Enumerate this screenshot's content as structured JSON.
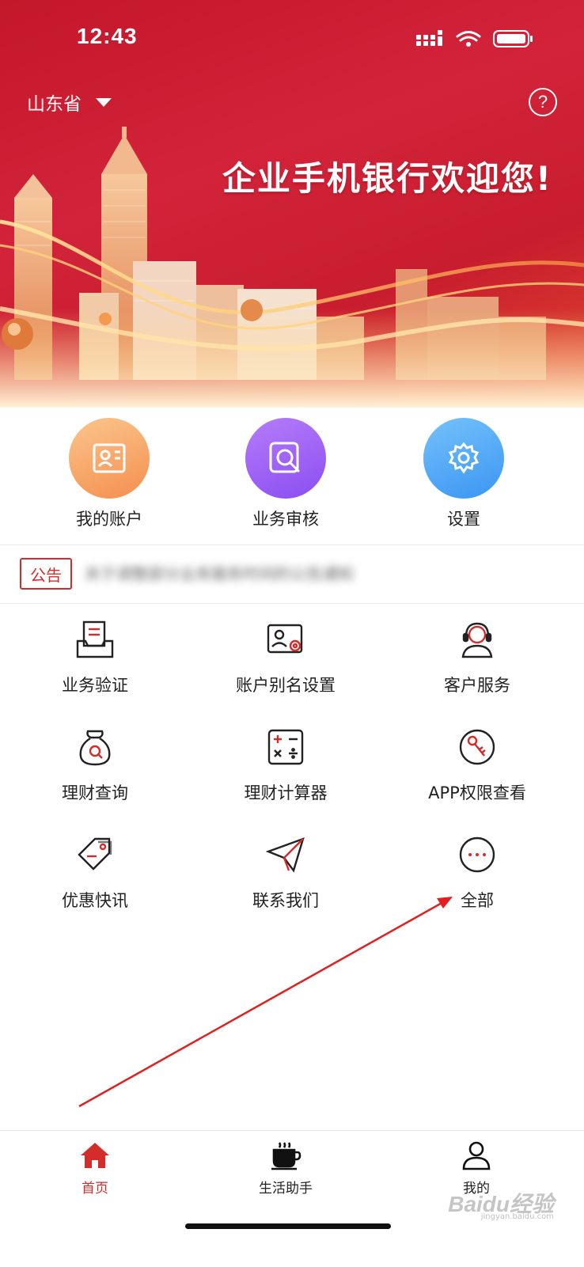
{
  "status_bar": {
    "time": "12:43"
  },
  "header": {
    "region": "山东省",
    "help_symbol": "?",
    "welcome": "企业手机银行欢迎您!"
  },
  "quick_actions": [
    {
      "label": "我的账户",
      "icon": "account-card-icon",
      "color": "#f7a35c"
    },
    {
      "label": "业务审核",
      "icon": "search-review-icon",
      "color": "#9a5cf5"
    },
    {
      "label": "设置",
      "icon": "gear-icon",
      "color": "#4aa6f7"
    }
  ],
  "notice": {
    "tag": "公告",
    "text": "关于调整部分业务服务时间的公告通知"
  },
  "services": [
    {
      "label": "业务验证",
      "icon": "document-tray-icon"
    },
    {
      "label": "账户别名设置",
      "icon": "id-card-gear-icon"
    },
    {
      "label": "客户服务",
      "icon": "headset-agent-icon"
    },
    {
      "label": "理财查询",
      "icon": "money-bag-search-icon"
    },
    {
      "label": "理财计算器",
      "icon": "calculator-icon"
    },
    {
      "label": "APP权限查看",
      "icon": "key-icon"
    },
    {
      "label": "优惠快讯",
      "icon": "tag-icon"
    },
    {
      "label": "联系我们",
      "icon": "paper-plane-icon"
    },
    {
      "label": "全部",
      "icon": "more-dots-icon"
    }
  ],
  "tabbar": [
    {
      "label": "首页",
      "icon": "home-icon",
      "active": true
    },
    {
      "label": "生活助手",
      "icon": "coffee-cup-icon",
      "active": false
    },
    {
      "label": "我的",
      "icon": "user-icon",
      "active": false
    }
  ],
  "watermark": {
    "text": "Baidu经验",
    "sub": "jingyan.baidu.com"
  },
  "colors": {
    "brand_red": "#c81d2e",
    "accent_red": "#d42b2b"
  }
}
